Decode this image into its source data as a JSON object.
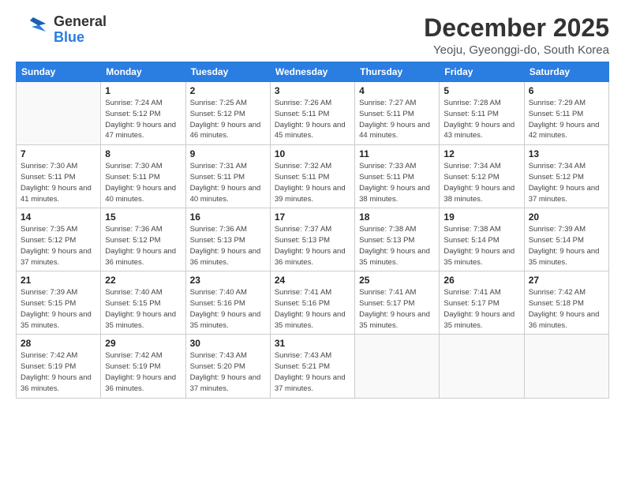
{
  "header": {
    "logo_general": "General",
    "logo_blue": "Blue",
    "title": "December 2025",
    "location": "Yeoju, Gyeonggi-do, South Korea"
  },
  "days_of_week": [
    "Sunday",
    "Monday",
    "Tuesday",
    "Wednesday",
    "Thursday",
    "Friday",
    "Saturday"
  ],
  "weeks": [
    [
      {
        "day": "",
        "sunrise": "",
        "sunset": "",
        "daylight": ""
      },
      {
        "day": "1",
        "sunrise": "Sunrise: 7:24 AM",
        "sunset": "Sunset: 5:12 PM",
        "daylight": "Daylight: 9 hours and 47 minutes."
      },
      {
        "day": "2",
        "sunrise": "Sunrise: 7:25 AM",
        "sunset": "Sunset: 5:12 PM",
        "daylight": "Daylight: 9 hours and 46 minutes."
      },
      {
        "day": "3",
        "sunrise": "Sunrise: 7:26 AM",
        "sunset": "Sunset: 5:11 PM",
        "daylight": "Daylight: 9 hours and 45 minutes."
      },
      {
        "day": "4",
        "sunrise": "Sunrise: 7:27 AM",
        "sunset": "Sunset: 5:11 PM",
        "daylight": "Daylight: 9 hours and 44 minutes."
      },
      {
        "day": "5",
        "sunrise": "Sunrise: 7:28 AM",
        "sunset": "Sunset: 5:11 PM",
        "daylight": "Daylight: 9 hours and 43 minutes."
      },
      {
        "day": "6",
        "sunrise": "Sunrise: 7:29 AM",
        "sunset": "Sunset: 5:11 PM",
        "daylight": "Daylight: 9 hours and 42 minutes."
      }
    ],
    [
      {
        "day": "7",
        "sunrise": "Sunrise: 7:30 AM",
        "sunset": "Sunset: 5:11 PM",
        "daylight": "Daylight: 9 hours and 41 minutes."
      },
      {
        "day": "8",
        "sunrise": "Sunrise: 7:30 AM",
        "sunset": "Sunset: 5:11 PM",
        "daylight": "Daylight: 9 hours and 40 minutes."
      },
      {
        "day": "9",
        "sunrise": "Sunrise: 7:31 AM",
        "sunset": "Sunset: 5:11 PM",
        "daylight": "Daylight: 9 hours and 40 minutes."
      },
      {
        "day": "10",
        "sunrise": "Sunrise: 7:32 AM",
        "sunset": "Sunset: 5:11 PM",
        "daylight": "Daylight: 9 hours and 39 minutes."
      },
      {
        "day": "11",
        "sunrise": "Sunrise: 7:33 AM",
        "sunset": "Sunset: 5:11 PM",
        "daylight": "Daylight: 9 hours and 38 minutes."
      },
      {
        "day": "12",
        "sunrise": "Sunrise: 7:34 AM",
        "sunset": "Sunset: 5:12 PM",
        "daylight": "Daylight: 9 hours and 38 minutes."
      },
      {
        "day": "13",
        "sunrise": "Sunrise: 7:34 AM",
        "sunset": "Sunset: 5:12 PM",
        "daylight": "Daylight: 9 hours and 37 minutes."
      }
    ],
    [
      {
        "day": "14",
        "sunrise": "Sunrise: 7:35 AM",
        "sunset": "Sunset: 5:12 PM",
        "daylight": "Daylight: 9 hours and 37 minutes."
      },
      {
        "day": "15",
        "sunrise": "Sunrise: 7:36 AM",
        "sunset": "Sunset: 5:12 PM",
        "daylight": "Daylight: 9 hours and 36 minutes."
      },
      {
        "day": "16",
        "sunrise": "Sunrise: 7:36 AM",
        "sunset": "Sunset: 5:13 PM",
        "daylight": "Daylight: 9 hours and 36 minutes."
      },
      {
        "day": "17",
        "sunrise": "Sunrise: 7:37 AM",
        "sunset": "Sunset: 5:13 PM",
        "daylight": "Daylight: 9 hours and 36 minutes."
      },
      {
        "day": "18",
        "sunrise": "Sunrise: 7:38 AM",
        "sunset": "Sunset: 5:13 PM",
        "daylight": "Daylight: 9 hours and 35 minutes."
      },
      {
        "day": "19",
        "sunrise": "Sunrise: 7:38 AM",
        "sunset": "Sunset: 5:14 PM",
        "daylight": "Daylight: 9 hours and 35 minutes."
      },
      {
        "day": "20",
        "sunrise": "Sunrise: 7:39 AM",
        "sunset": "Sunset: 5:14 PM",
        "daylight": "Daylight: 9 hours and 35 minutes."
      }
    ],
    [
      {
        "day": "21",
        "sunrise": "Sunrise: 7:39 AM",
        "sunset": "Sunset: 5:15 PM",
        "daylight": "Daylight: 9 hours and 35 minutes."
      },
      {
        "day": "22",
        "sunrise": "Sunrise: 7:40 AM",
        "sunset": "Sunset: 5:15 PM",
        "daylight": "Daylight: 9 hours and 35 minutes."
      },
      {
        "day": "23",
        "sunrise": "Sunrise: 7:40 AM",
        "sunset": "Sunset: 5:16 PM",
        "daylight": "Daylight: 9 hours and 35 minutes."
      },
      {
        "day": "24",
        "sunrise": "Sunrise: 7:41 AM",
        "sunset": "Sunset: 5:16 PM",
        "daylight": "Daylight: 9 hours and 35 minutes."
      },
      {
        "day": "25",
        "sunrise": "Sunrise: 7:41 AM",
        "sunset": "Sunset: 5:17 PM",
        "daylight": "Daylight: 9 hours and 35 minutes."
      },
      {
        "day": "26",
        "sunrise": "Sunrise: 7:41 AM",
        "sunset": "Sunset: 5:17 PM",
        "daylight": "Daylight: 9 hours and 35 minutes."
      },
      {
        "day": "27",
        "sunrise": "Sunrise: 7:42 AM",
        "sunset": "Sunset: 5:18 PM",
        "daylight": "Daylight: 9 hours and 36 minutes."
      }
    ],
    [
      {
        "day": "28",
        "sunrise": "Sunrise: 7:42 AM",
        "sunset": "Sunset: 5:19 PM",
        "daylight": "Daylight: 9 hours and 36 minutes."
      },
      {
        "day": "29",
        "sunrise": "Sunrise: 7:42 AM",
        "sunset": "Sunset: 5:19 PM",
        "daylight": "Daylight: 9 hours and 36 minutes."
      },
      {
        "day": "30",
        "sunrise": "Sunrise: 7:43 AM",
        "sunset": "Sunset: 5:20 PM",
        "daylight": "Daylight: 9 hours and 37 minutes."
      },
      {
        "day": "31",
        "sunrise": "Sunrise: 7:43 AM",
        "sunset": "Sunset: 5:21 PM",
        "daylight": "Daylight: 9 hours and 37 minutes."
      },
      {
        "day": "",
        "sunrise": "",
        "sunset": "",
        "daylight": ""
      },
      {
        "day": "",
        "sunrise": "",
        "sunset": "",
        "daylight": ""
      },
      {
        "day": "",
        "sunrise": "",
        "sunset": "",
        "daylight": ""
      }
    ]
  ]
}
